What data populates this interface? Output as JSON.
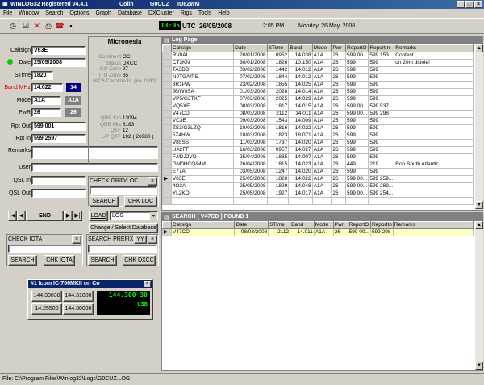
{
  "title": {
    "app": "WINLOG32 Registered  v4.4.1",
    "user": "Colin",
    "call": "G0CUZ",
    "loc": "IO82WM"
  },
  "menu": [
    "File",
    "Window",
    "Search",
    "Options",
    "Graph",
    "Database",
    "DXCluster",
    "Rigs",
    "Tools",
    "Help"
  ],
  "clock": {
    "utc_time": "13:05",
    "utc_label": "UTC",
    "utc_date": "26/05/2008",
    "local_time": "2:05 PM",
    "local_date": "Monday, 26 May, 2008"
  },
  "entry": {
    "callsign_label": "Callsign",
    "callsign": "V63E",
    "date_label": "Date",
    "date": "25/05/2008",
    "stime_label": "STime",
    "stime": "1820",
    "band_label": "Band MHz",
    "band": "14.022",
    "band_num": "14",
    "mode_label": "Mode",
    "mode": "A1A",
    "mode2": "A1A",
    "pwr_label": "PwR",
    "pwr": "26",
    "pwr2": "26",
    "rptout_label": "Rpt Out",
    "rptout": "599 001",
    "rptin_label": "Rpt In",
    "rptin": "599 2597",
    "remarks_label": "Remarks",
    "user_label": "User",
    "qslin_label": "QSL In",
    "qslout_label": "QSL Out"
  },
  "country": {
    "name": "Micronesia",
    "continent_label": "Continent",
    "continent": "OC",
    "status_label": "Status",
    "status": "DXCC",
    "cq_label": "CQ Zone",
    "cq": "27",
    "itu_label": "ITU Zone",
    "itu": "65",
    "note": "(KC6 Caroline Is. pre 1990)",
    "qrb_km_label": "QRB Km",
    "qrb_km": "13094",
    "qrb_mls_label": "QRB Mls",
    "qrb_mls": "8183",
    "qtf_label": "QTF",
    "qtf": "12",
    "lpqtf_label": "L/P QTF",
    "lpqtf": "192  ( 26980 )"
  },
  "buttons": {
    "check_grid": "CHECK GRID/LOC",
    "search": "SEARCH",
    "chk_loc": "CHK LOC",
    "end": "END",
    "load": "LOAD",
    "log": "LOG",
    "change_db": "Change / Select Database",
    "check_iota": "CHECK IOTA",
    "chk_iota": "CHK IOTA",
    "search_prefix": "SEARCH PREFIX",
    "yy": "YY",
    "chk_dxcc": "CHK DXCC",
    "search2": "SEARCH",
    "search3": "SEARCH"
  },
  "rig": {
    "title": "#1 Icom IC-706MKII on Co",
    "mem": [
      "144.30030",
      "144.31000",
      "14.25500",
      "144.30030"
    ],
    "freq": "144.300 30",
    "mode": "USB"
  },
  "logpage": {
    "title": "Log Page",
    "columns": [
      "Callsign",
      "Date",
      "STime",
      "Band",
      "Mode",
      "Pwr",
      "ReportO",
      "ReportIn",
      "Remarks"
    ],
    "rows": [
      [
        "RV0AL",
        "20/01/2008",
        "0952",
        "14.038",
        "A1A",
        "26",
        "599 00...",
        "599 153",
        "Contest"
      ],
      [
        "CT3KN",
        "30/01/2008",
        "1826",
        "10.150",
        "A1A",
        "26",
        "599",
        "599",
        "on 20m dipole!"
      ],
      [
        "TA3DD",
        "03/02/2008",
        "1442",
        "14.012",
        "A1A",
        "26",
        "599",
        "599",
        ""
      ],
      [
        "N0TG/VP5",
        "07/02/2008",
        "1844",
        "14.012",
        "A1A",
        "26",
        "599",
        "599",
        ""
      ],
      [
        "8R1PW",
        "23/02/2008",
        "1855",
        "14.025",
        "A1A",
        "26",
        "599",
        "599",
        ""
      ],
      [
        "J6/W0SA",
        "01/03/2008",
        "2028",
        "14.014",
        "A1A",
        "26",
        "599",
        "599",
        ""
      ],
      [
        "VP5/G3TXF",
        "07/03/2008",
        "2025",
        "14.029",
        "A1A",
        "26",
        "599",
        "599",
        ""
      ],
      [
        "VQ5XF",
        "08/03/2008",
        "1817",
        "14.015",
        "A1A",
        "26",
        "599 00...",
        "599 537",
        ""
      ],
      [
        "V47CD",
        "08/03/2008",
        "2112",
        "14.011",
        "A1A",
        "26",
        "599 00...",
        "599 298",
        ""
      ],
      [
        "VC3E",
        "09/03/2008",
        "1543",
        "14.009",
        "A1A",
        "26",
        "599",
        "599",
        ""
      ],
      [
        "ZS3/G3LZQ",
        "10/03/2008",
        "1816",
        "14.022",
        "A1A",
        "26",
        "599",
        "599",
        ""
      ],
      [
        "5Z4HW",
        "10/03/2008",
        "1823",
        "18.071",
        "A1A",
        "26",
        "599",
        "599",
        ""
      ],
      [
        "V85SS",
        "11/03/2008",
        "1737",
        "14.020",
        "A1A",
        "26",
        "599",
        "599",
        ""
      ],
      [
        "UA2FF",
        "16/03/2008",
        "0957",
        "14.027",
        "A1A",
        "26",
        "599",
        "599",
        ""
      ],
      [
        "FJ/DJ2VO",
        "25/04/2008",
        "1835",
        "14.007",
        "A1A",
        "26",
        "599",
        "599",
        ""
      ],
      [
        "GM0HCQ/MM",
        "26/04/2008",
        "1815",
        "14.023",
        "A1A",
        "26",
        "449",
        "219",
        "Ron South Atlantic"
      ],
      [
        "E77A",
        "03/05/2008",
        "1247",
        "14.020",
        "A1A",
        "26",
        "599",
        "599",
        ""
      ],
      [
        "V63E",
        "25/05/2008",
        "1820",
        "14.022",
        "A1A",
        "26",
        "599 00...",
        "599 259...",
        ""
      ],
      [
        "4O3A",
        "25/05/2008",
        "1829",
        "14.048",
        "A1A",
        "26",
        "599 00...",
        "599 289...",
        ""
      ],
      [
        "YL2KO",
        "25/05/2008",
        "1927",
        "14.017",
        "A1A",
        "26",
        "599 00...",
        "599 254...",
        ""
      ]
    ]
  },
  "searchpage": {
    "title": "SEARCH  [ V47CD ] FOUND  1",
    "columns": [
      "Callsign",
      "Date",
      "STime",
      "Band",
      "Mode",
      "Pwr",
      "ReportO",
      "ReportIn",
      "Remarks"
    ],
    "rows": [
      [
        "V47CD",
        "08/03/2008",
        "2112",
        "14.011",
        "A1A",
        "26",
        "599 00...",
        "599 298",
        ""
      ]
    ]
  },
  "status": "File: C:\\Program Files\\Winlog32\\Logs\\G0CUZ.LOG"
}
